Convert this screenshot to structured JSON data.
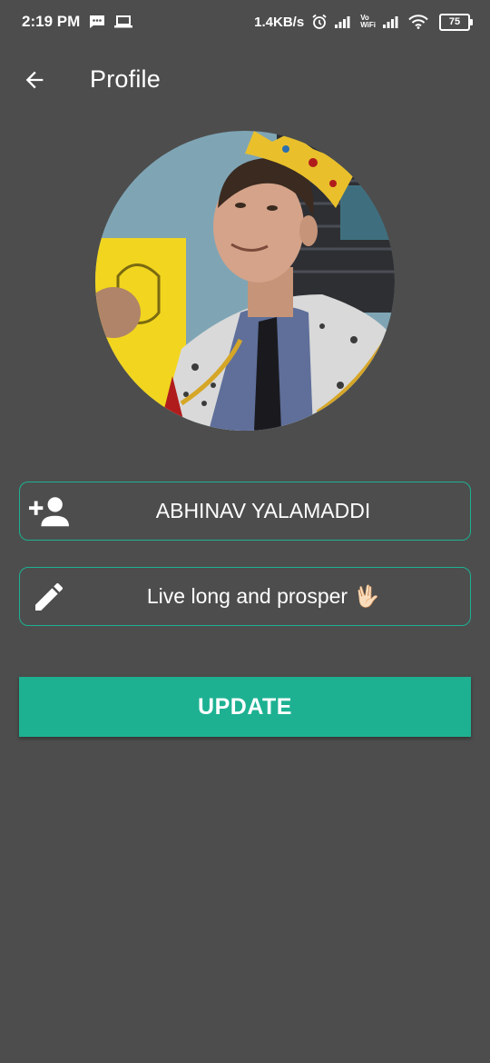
{
  "status_bar": {
    "time": "2:19 PM",
    "network_speed": "1.4KB/s",
    "vo_label": "Vo",
    "wifi_label": "WiFi",
    "battery": "75"
  },
  "header": {
    "title": "Profile"
  },
  "profile": {
    "name": "ABHINAV YALAMADDI",
    "status": "Live long and prosper 🖖🏻"
  },
  "actions": {
    "update_label": "UPDATE"
  },
  "colors": {
    "background": "#4d4d4d",
    "accent": "#1db192",
    "text": "#ffffff"
  }
}
